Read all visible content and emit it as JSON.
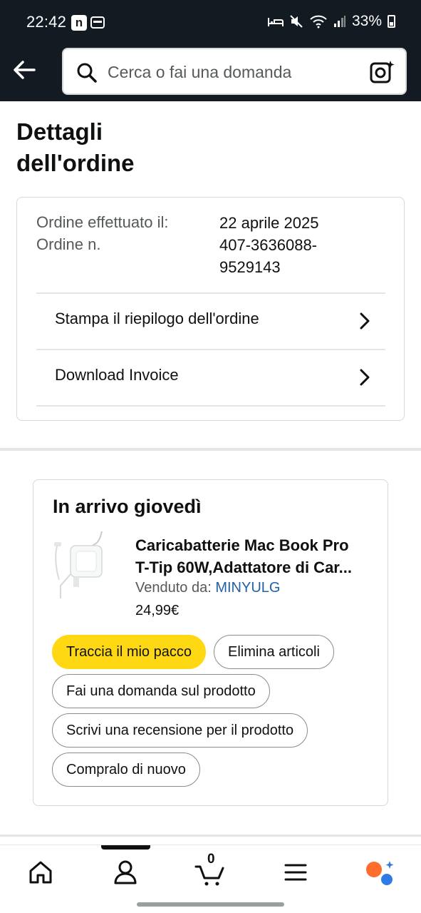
{
  "status_bar": {
    "time": "22:42",
    "n_badge": "n",
    "battery_percent": "33%"
  },
  "search": {
    "placeholder": "Cerca o fai una domanda"
  },
  "page": {
    "title_line1": "Dettagli",
    "title_line2": "dell'ordine"
  },
  "order": {
    "placed_label": "Ordine effettuato il:",
    "placed_value": "22 aprile 2025",
    "number_label": "Ordine n.",
    "number_value_line1": "407-3636088-",
    "number_value_line2": "9529143",
    "links": [
      {
        "label": "Stampa il riepilogo dell'ordine"
      },
      {
        "label": "Download Invoice"
      }
    ]
  },
  "shipment": {
    "title": "In arrivo giovedì",
    "product_name_line1": "Caricabatterie Mac Book Pro",
    "product_name_line2": "T-Tip 60W,Adattatore di Car...",
    "sold_by_label": "Venduto da:",
    "sold_by_name": "MINYULG",
    "price": "24,99€",
    "actions": [
      {
        "label": "Traccia il mio pacco"
      },
      {
        "label": "Elimina articoli"
      },
      {
        "label": "Fai una domanda sul prodotto"
      },
      {
        "label": "Scrivi una recensione per il prodotto"
      },
      {
        "label": "Compralo di nuovo"
      }
    ]
  },
  "bottom_nav": {
    "items": [
      "home-icon",
      "account-icon",
      "cart-icon",
      "menu-icon",
      "rufus-icon"
    ],
    "cart_count": "0"
  },
  "colors": {
    "header_bg": "#131a22",
    "primary_button": "#ffd814",
    "link": "#2162a1",
    "rufus_orange": "#ff6d2d",
    "rufus_blue": "#2f7ae5"
  }
}
